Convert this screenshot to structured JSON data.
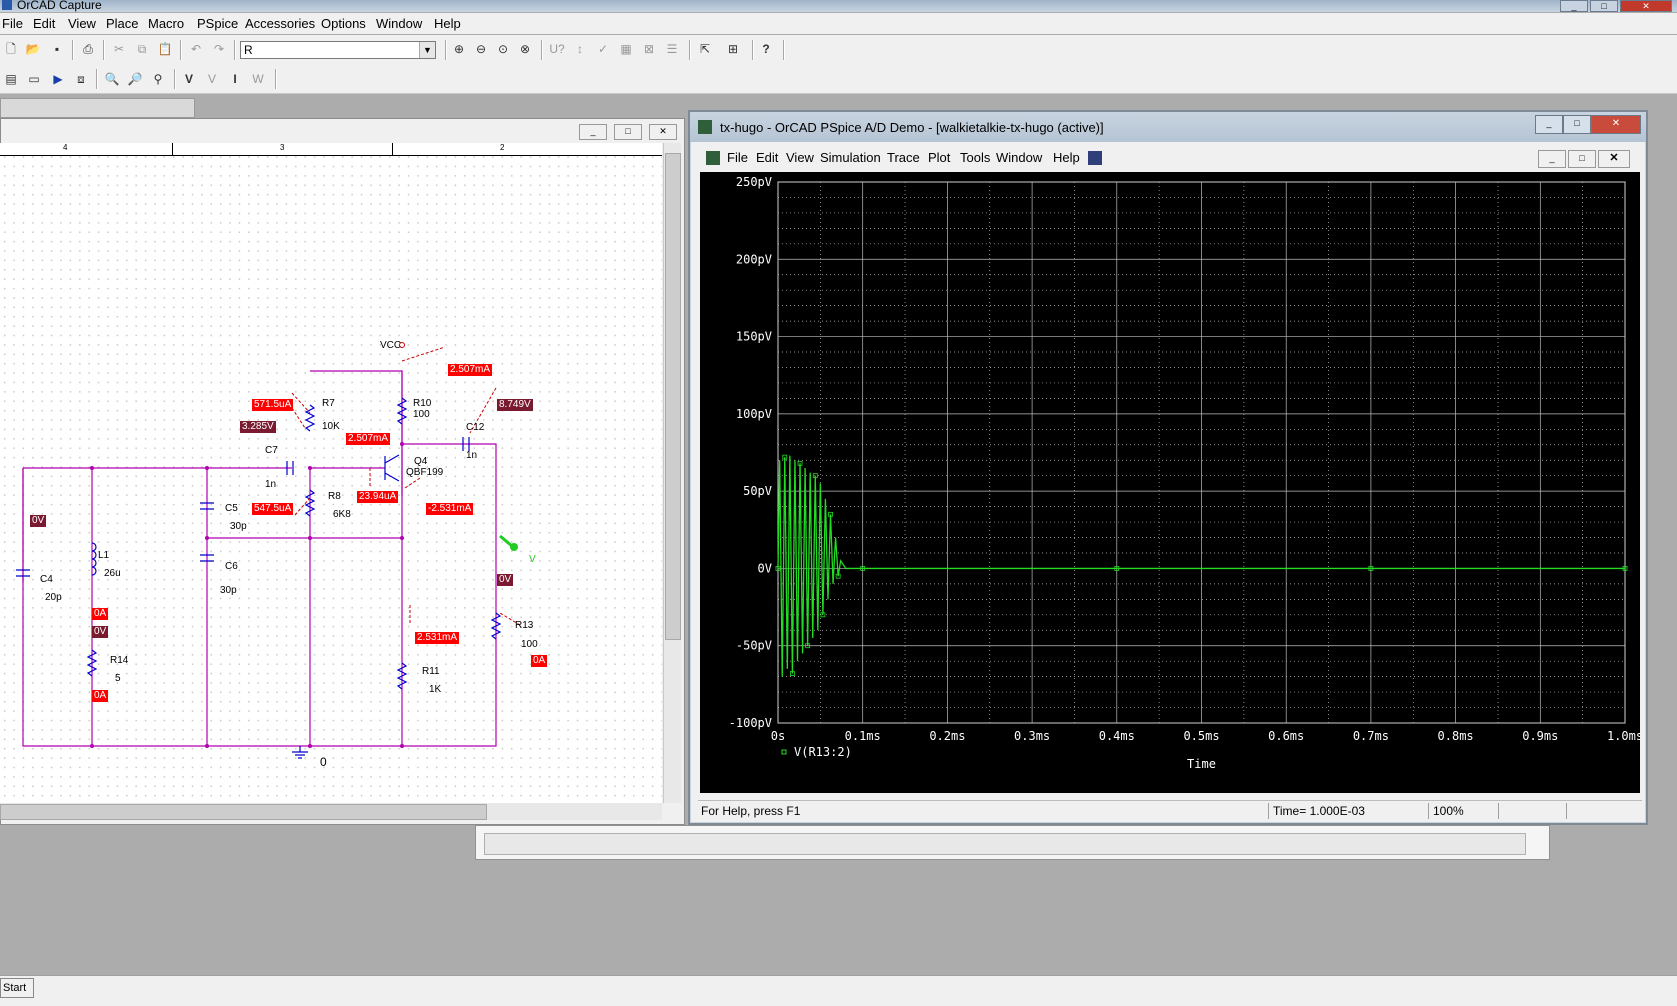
{
  "app": {
    "title": "OrCAD Capture",
    "menu": [
      "File",
      "Edit",
      "View",
      "Place",
      "Macro",
      "PSpice",
      "Accessories",
      "Options",
      "Window",
      "Help"
    ],
    "part_combo_value": "R",
    "taskbar_start": "Start"
  },
  "probe_window": {
    "title": "tx-hugo - OrCAD PSpice A/D Demo  - [walkietalkie-tx-hugo (active)]",
    "menu": [
      "File",
      "Edit",
      "View",
      "Simulation",
      "Trace",
      "Plot",
      "Tools",
      "Window",
      "Help"
    ],
    "status_help": "For Help, press F1",
    "status_time": "Time= 1.000E-03",
    "status_zoom": "100%"
  },
  "schematic": {
    "ruler_labels": [
      "4",
      "3",
      "2"
    ],
    "labels": {
      "vcc": "VCC",
      "r7": "R7",
      "r7v": "10K",
      "r10": "R10",
      "r10v": "100",
      "c7": "C7",
      "c7v": "1n",
      "q4": "Q4",
      "q4v": "QBF199",
      "c12": "C12",
      "c12v": "1n",
      "r8": "R8",
      "r8v": "6K8",
      "c5": "C5",
      "c5v": "30p",
      "c6": "C6",
      "c6v": "30p",
      "c4": "C4",
      "c4v": "20p",
      "l1": "L1",
      "l1v": "26u",
      "r14": "R14",
      "r14v": "5",
      "r11": "R11",
      "r11v": "1K",
      "r13": "R13",
      "r13v": "100",
      "gnd": "0",
      "probe": "V"
    },
    "annotations": {
      "a1": "2.507mA",
      "a2": "571.5uA",
      "a3": "8.749V",
      "a4": "3.285V",
      "a5": "2.507mA",
      "a6": "547.5uA",
      "a7": "23.94uA",
      "a8": "-2.531mA",
      "a9": "0V",
      "a10": "0A",
      "a11": "0V",
      "a12": "0A",
      "a13": "0V",
      "a14": "2.531mA",
      "a15": "0A"
    }
  },
  "chart_data": {
    "type": "line",
    "xlabel": "Time",
    "ylabel": "",
    "x_ticks": [
      "0s",
      "0.1ms",
      "0.2ms",
      "0.3ms",
      "0.4ms",
      "0.5ms",
      "0.6ms",
      "0.7ms",
      "0.8ms",
      "0.9ms",
      "1.0ms"
    ],
    "y_ticks": [
      "250pV",
      "200pV",
      "150pV",
      "100pV",
      "50pV",
      "0V",
      "-50pV",
      "-100pV"
    ],
    "xlim": [
      0,
      1.0
    ],
    "ylim": [
      -100,
      250
    ],
    "grid": true,
    "series": [
      {
        "name": "V(R13:2)",
        "color": "#22dd22",
        "x": [
          0,
          0.002,
          0.005,
          0.008,
          0.011,
          0.014,
          0.017,
          0.02,
          0.023,
          0.026,
          0.029,
          0.032,
          0.035,
          0.038,
          0.041,
          0.044,
          0.047,
          0.05,
          0.053,
          0.056,
          0.059,
          0.062,
          0.065,
          0.068,
          0.071,
          0.074,
          0.08,
          0.1,
          0.2,
          0.3,
          0.4,
          0.5,
          0.6,
          0.7,
          0.8,
          0.9,
          1.0
        ],
        "y": [
          0,
          70,
          -70,
          72,
          -65,
          73,
          -68,
          70,
          -60,
          68,
          -55,
          65,
          -50,
          62,
          -45,
          60,
          -40,
          55,
          -30,
          45,
          -20,
          35,
          -10,
          20,
          -5,
          5,
          0,
          0,
          0,
          0,
          0,
          0,
          0,
          0,
          0,
          0,
          0
        ]
      }
    ]
  }
}
